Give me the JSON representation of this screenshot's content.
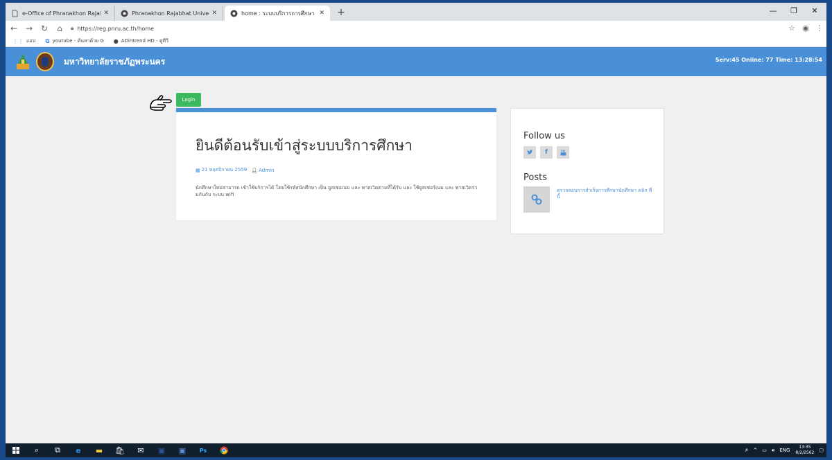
{
  "browser": {
    "tabs": [
      {
        "label": "e-Office of Phranakhon Rajabhat",
        "icon": "document-icon",
        "active": false
      },
      {
        "label": "Phranakhon Rajabhat University",
        "icon": "site-icon",
        "active": false
      },
      {
        "label": "home : ระบบบริการการศึกษา มหาวิท",
        "icon": "site-icon",
        "active": true
      }
    ],
    "newtab_label": "+",
    "url": "https://reg.pnru.ac.th/home",
    "bookmarks": [
      {
        "label": "แอป",
        "icon": "apps-icon"
      },
      {
        "label": "youtube - ค้นหาด้วย G",
        "icon": "google-icon"
      },
      {
        "label": "ADintrend HD - ดูทีวี",
        "icon": "adintrend-icon"
      }
    ]
  },
  "site": {
    "name": "มหาวิทยาลัยราชภัฏพระนคร",
    "server_status": "Serv:45 Online: 77 Time: 13:28:54"
  },
  "main": {
    "login_label": "Login",
    "welcome_title": "ยินดีต้อนรับเข้าสู่ระบบบริการศึกษา",
    "date": "21 พฤศจิกายน 2559",
    "author": "Admin",
    "body": "นักศึกษาใหม่สามารถ เข้าใช้บริการได้ โดยใช้รหัสนักศึกษา เป็น ยูสเซอเนม และ พาสเวิดตามที่ได้รับ และ ใช้ยูสเซอร์เนม และ พาสเวิดร่วมกันกับ ระบบ wifi"
  },
  "sidebar": {
    "follow_title": "Follow us",
    "social": [
      "twitter-icon",
      "facebook-icon",
      "youtube-icon"
    ],
    "posts_title": "Posts",
    "post_link": "ตรวจสอบการสำเร็จการศึกษานักศึกษา คลิก ที่นี้"
  },
  "taskbar": {
    "language": "ENG",
    "time": "13:35",
    "date": "8/2/2562"
  },
  "colors": {
    "header": "#4a90d9",
    "login": "#3cb860",
    "taskbar": "#101e2e"
  }
}
